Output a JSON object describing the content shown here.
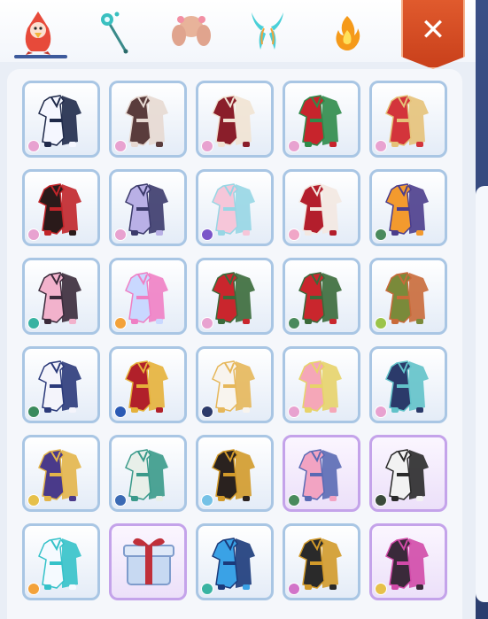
{
  "tabs": [
    {
      "name": "outfit-tab",
      "icon": "bird-costume-icon",
      "active": true
    },
    {
      "name": "wand-tab",
      "icon": "wand-icon",
      "active": false
    },
    {
      "name": "hair-tab",
      "icon": "hair-icon",
      "active": false
    },
    {
      "name": "wings-tab",
      "icon": "wings-icon",
      "active": false
    },
    {
      "name": "effect-tab",
      "icon": "fire-effect-icon",
      "active": false
    }
  ],
  "close_label": "✕",
  "colors": {
    "accent": "#3d5a9c",
    "close": "#d24a22",
    "cell_border": "#a9c6e4",
    "cell_border_rare": "#c4a3ea"
  },
  "items": [
    {
      "name": "white-navy-outfit",
      "c1": "#f5f7ff",
      "c2": "#1f2a4a",
      "dye": "#e8a2d0",
      "rare": false
    },
    {
      "name": "brown-coat-outfit",
      "c1": "#5a3c3c",
      "c2": "#e7d9d2",
      "dye": "#e8a2d0",
      "rare": false
    },
    {
      "name": "crimson-kimono-outfit",
      "c1": "#8a1e2a",
      "c2": "#f1e3d3",
      "dye": "#e8a2d0",
      "rare": false
    },
    {
      "name": "red-green-outfit",
      "c1": "#c7242c",
      "c2": "#2f8b4a",
      "dye": "#e8a2d0",
      "rare": false
    },
    {
      "name": "red-gold-outfit",
      "c1": "#d3343b",
      "c2": "#e5c279",
      "dye": "#e8a2d0",
      "rare": false
    },
    {
      "name": "black-red-dress",
      "c1": "#2a1a1a",
      "c2": "#c1252a",
      "dye": "#e8a2d0",
      "rare": false
    },
    {
      "name": "lavender-mech-outfit",
      "c1": "#b9b0e6",
      "c2": "#3b3a6b",
      "dye": "#e8a2d0",
      "rare": false
    },
    {
      "name": "pink-magic-outfit",
      "c1": "#f6c6d9",
      "c2": "#97d6e4",
      "dye": "#7a55c9",
      "rare": false
    },
    {
      "name": "red-hood-outfit",
      "c1": "#b31e2c",
      "c2": "#f3e8e1",
      "dye": "#f0a6c7",
      "rare": false
    },
    {
      "name": "orange-witch-outfit",
      "c1": "#f39a2e",
      "c2": "#4b3d8c",
      "dye": "#4a8a5c",
      "rare": false
    },
    {
      "name": "pink-hoodie-outfit",
      "c1": "#f2b2cc",
      "c2": "#3a2a3a",
      "dye": "#38b3a2",
      "rare": false
    },
    {
      "name": "blue-bunny-outfit",
      "c1": "#c9d8ff",
      "c2": "#ef7fc4",
      "dye": "#f3a23a",
      "rare": false
    },
    {
      "name": "red-armor-outfit",
      "c1": "#c9262d",
      "c2": "#3a6a3a",
      "dye": "#e8a2d0",
      "rare": false
    },
    {
      "name": "red-armor-outfit-2",
      "c1": "#c9262d",
      "c2": "#3a6a3a",
      "dye": "#4a8a5c",
      "rare": false
    },
    {
      "name": "forest-gown-outfit",
      "c1": "#7a8a3a",
      "c2": "#c96a3a",
      "dye": "#9bc44a",
      "rare": false
    },
    {
      "name": "white-blue-robe",
      "c1": "#f4f4fb",
      "c2": "#2b3a7a",
      "dye": "#3a8a5c",
      "rare": false
    },
    {
      "name": "crimson-dragon-outfit",
      "c1": "#b1202a",
      "c2": "#e5b13a",
      "dye": "#2b5ab4",
      "rare": false
    },
    {
      "name": "white-gold-dress",
      "c1": "#f8f4ee",
      "c2": "#e6b75a",
      "dye": "#2c3a6a",
      "rare": false
    },
    {
      "name": "pink-idol-dress",
      "c1": "#f5a7b8",
      "c2": "#e7d36a",
      "dye": "#e8a2d0",
      "rare": false
    },
    {
      "name": "navy-teal-outfit",
      "c1": "#2b3a6a",
      "c2": "#62c2c9",
      "dye": "#e8a2d0",
      "rare": false
    },
    {
      "name": "violet-gold-armor",
      "c1": "#4a3a8a",
      "c2": "#e3b54a",
      "dye": "#e6c04a",
      "rare": false
    },
    {
      "name": "white-teal-armor",
      "c1": "#e8efe9",
      "c2": "#3a9a8a",
      "dye": "#3b6ab4",
      "rare": false
    },
    {
      "name": "black-gold-outfit",
      "c1": "#2a221f",
      "c2": "#d29a2a",
      "dye": "#74c1e6",
      "rare": false
    },
    {
      "name": "pastel-pink-dress",
      "c1": "#f2a3c2",
      "c2": "#5a6ab4",
      "dye": "#4a8a5c",
      "rare": true
    },
    {
      "name": "panda-outfit",
      "c1": "#f2f2f2",
      "c2": "#2a2a2a",
      "dye": "#3a4a3a",
      "rare": true
    },
    {
      "name": "white-teal-uniform",
      "c1": "#f5faff",
      "c2": "#35c2c9",
      "dye": "#f3a23a",
      "rare": false
    },
    {
      "name": "mystery-gift-box",
      "c1": "#c7d9f2",
      "c2": "#c0303a",
      "dye": "",
      "rare": true
    },
    {
      "name": "blue-sport-outfit",
      "c1": "#3aa2e6",
      "c2": "#1b3a7a",
      "dye": "#38b3a2",
      "rare": false
    },
    {
      "name": "black-gold-armor",
      "c1": "#2a2a2a",
      "c2": "#d29a2a",
      "dye": "#d274c9",
      "rare": false
    },
    {
      "name": "black-magenta-outfit",
      "c1": "#3a2a3a",
      "c2": "#d14aa8",
      "dye": "#e6c04a",
      "rare": true
    }
  ]
}
